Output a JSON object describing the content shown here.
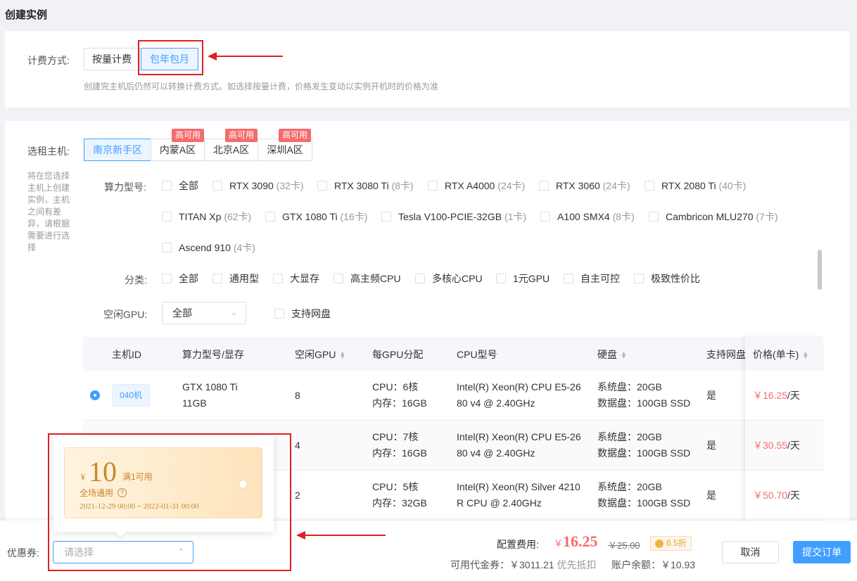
{
  "page": {
    "title": "创建实例"
  },
  "billing": {
    "label": "计费方式:",
    "options": [
      "按量计费",
      "包年包月"
    ],
    "hint": "创建完主机后仍然可以转换计费方式。如选择按量计费，价格发生变动以实例开机时的价格为准"
  },
  "host": {
    "label": "选租主机:",
    "side_note": "将在您选择主机上创建实例，主机之间有差异，请根据需要进行选择",
    "regions": [
      "南京新手区",
      "内蒙A区",
      "北京A区",
      "深圳A区"
    ],
    "region_badge": "高可用"
  },
  "gpu_models": {
    "label": "算力型号:",
    "items": [
      {
        "name": "全部",
        "count": ""
      },
      {
        "name": "RTX 3090",
        "count": "(32卡)"
      },
      {
        "name": "RTX 3080 Ti",
        "count": "(8卡)"
      },
      {
        "name": "RTX A4000",
        "count": "(24卡)"
      },
      {
        "name": "RTX 3060",
        "count": "(24卡)"
      },
      {
        "name": "RTX 2080 Ti",
        "count": "(40卡)"
      },
      {
        "name": "TITAN Xp",
        "count": "(62卡)"
      },
      {
        "name": "GTX 1080 Ti",
        "count": "(16卡)"
      },
      {
        "name": "Tesla V100-PCIE-32GB",
        "count": "(1卡)"
      },
      {
        "name": "A100 SMX4",
        "count": "(8卡)"
      },
      {
        "name": "Cambricon MLU270",
        "count": "(7卡)"
      },
      {
        "name": "Ascend 910",
        "count": "(4卡)"
      }
    ]
  },
  "category": {
    "label": "分类:",
    "items": [
      "全部",
      "通用型",
      "大显存",
      "高主频CPU",
      "多核心CPU",
      "1元GPU",
      "自主可控",
      "极致性价比"
    ]
  },
  "idle_gpu": {
    "label": "空闲GPU:",
    "value": "全部",
    "netdisk_label": "支持网盘"
  },
  "table": {
    "headers": [
      "主机ID",
      "算力型号/显存",
      "空闲GPU",
      "每GPU分配",
      "CPU型号",
      "硬盘",
      "支持网盘",
      "价格(单卡)"
    ],
    "rows": [
      {
        "id": "040机",
        "model": "GTX 1080 Ti",
        "vram": "11GB",
        "idle": "8",
        "cpu_alloc": "CPU：6核",
        "mem_alloc": "内存：16GB",
        "cpu_model_1": "Intel(R) Xeon(R) CPU E5-26",
        "cpu_model_2": "80 v4 @ 2.40GHz",
        "sys_disk": "系统盘：20GB",
        "data_disk": "数据盘：100GB SSD",
        "netdisk": "是",
        "price": "￥16.25",
        "unit": "/天"
      },
      {
        "id": "",
        "model": "",
        "vram": "",
        "idle": "4",
        "cpu_alloc": "CPU：7核",
        "mem_alloc": "内存：16GB",
        "cpu_model_1": "Intel(R) Xeon(R) CPU E5-26",
        "cpu_model_2": "80 v4 @ 2.40GHz",
        "sys_disk": "系统盘：20GB",
        "data_disk": "数据盘：100GB SSD",
        "netdisk": "是",
        "price": "￥30.55",
        "unit": "/天"
      },
      {
        "id": "",
        "model": "",
        "vram": "",
        "idle": "2",
        "cpu_alloc": "CPU：5核",
        "mem_alloc": "内存：32GB",
        "cpu_model_1": "Intel(R) Xeon(R) Silver 4210",
        "cpu_model_2": "R CPU @ 2.40GHz",
        "sys_disk": "系统盘：20GB",
        "data_disk": "数据盘：100GB SSD",
        "netdisk": "是",
        "price": "￥50.70",
        "unit": "/天"
      }
    ]
  },
  "coupon": {
    "label": "优惠券:",
    "placeholder": "请选择",
    "card": {
      "currency": "¥",
      "amount": "10",
      "condition": "满1可用",
      "scope": "全场通用",
      "dates": "2021-12-29 00:00 ~ 2022-01-31 00:00"
    }
  },
  "summary": {
    "fee_label": "配置费用:",
    "fee_currency": "￥",
    "fee_value": "16.25",
    "original_price": "￥25.00",
    "discount": "6.5折",
    "voucher_text": "可用代金券：￥3011.21",
    "voucher_priority": "优先抵扣",
    "balance_text": "账户余额：￥10.93"
  },
  "buttons": {
    "cancel": "取消",
    "submit": "提交订单"
  },
  "colors": {
    "primary": "#409eff",
    "price": "#f56c6c",
    "annotation": "#e02020",
    "coupon": "#c8862c"
  }
}
